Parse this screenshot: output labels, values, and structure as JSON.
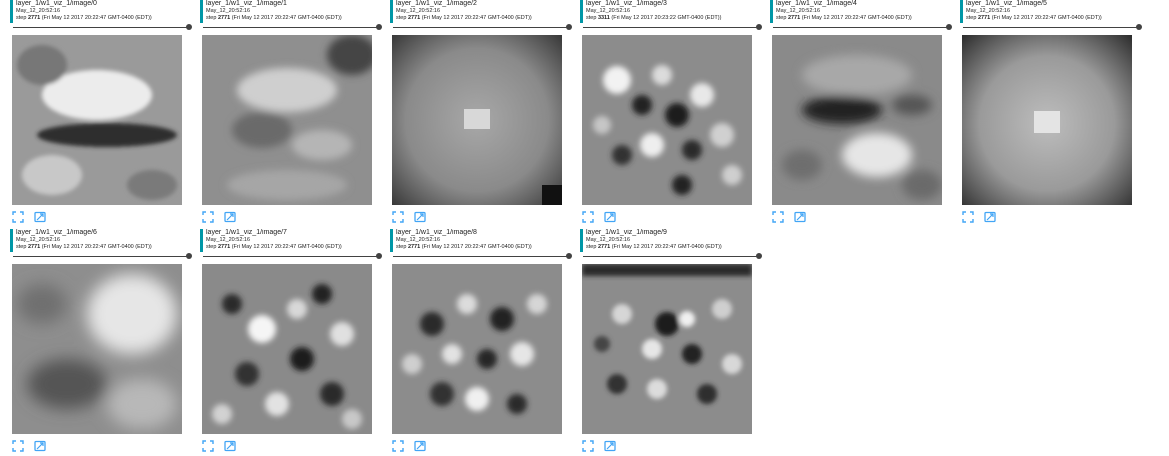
{
  "images": [
    {
      "title": "layer_1/w1_viz_1/image/0",
      "time": "May_12_20:52:16",
      "step_label": "step",
      "step": "2771",
      "timestamp": "(Fri May 12 2017 20:22:47 GMT-0400 (EDT))"
    },
    {
      "title": "layer_1/w1_viz_1/image/1",
      "time": "May_12_20:52:16",
      "step_label": "step",
      "step": "2771",
      "timestamp": "(Fri May 12 2017 20:22:47 GMT-0400 (EDT))"
    },
    {
      "title": "layer_1/w1_viz_1/image/2",
      "time": "May_12_20:52:16",
      "step_label": "step",
      "step": "2771",
      "timestamp": "(Fri May 12 2017 20:22:47 GMT-0400 (EDT))"
    },
    {
      "title": "layer_1/w1_viz_1/image/3",
      "time": "May_12_20:52:16",
      "step_label": "step",
      "step": "3311",
      "timestamp": "(Fri May 12 2017 20:23:22 GMT-0400 (EDT))"
    },
    {
      "title": "layer_1/w1_viz_1/image/4",
      "time": "May_12_20:52:16",
      "step_label": "step",
      "step": "2771",
      "timestamp": "(Fri May 12 2017 20:22:47 GMT-0400 (EDT))"
    },
    {
      "title": "layer_1/w1_viz_1/image/5",
      "time": "May_12_20:52:16",
      "step_label": "step",
      "step": "2771",
      "timestamp": "(Fri May 12 2017 20:22:47 GMT-0400 (EDT))"
    },
    {
      "title": "layer_1/w1_viz_1/image/6",
      "time": "May_12_20:52:16",
      "step_label": "step",
      "step": "2771",
      "timestamp": "(Fri May 12 2017 20:22:47 GMT-0400 (EDT))"
    },
    {
      "title": "layer_1/w1_viz_1/image/7",
      "time": "May_12_20:52:16",
      "step_label": "step",
      "step": "2771",
      "timestamp": "(Fri May 12 2017 20:22:47 GMT-0400 (EDT))"
    },
    {
      "title": "layer_1/w1_viz_1/image/8",
      "time": "May_12_20:52:16",
      "step_label": "step",
      "step": "2771",
      "timestamp": "(Fri May 12 2017 20:22:47 GMT-0400 (EDT))"
    },
    {
      "title": "layer_1/w1_viz_1/image/9",
      "time": "May_12_20:52:16",
      "step_label": "step",
      "step": "2771",
      "timestamp": "(Fri May 12 2017 20:22:47 GMT-0400 (EDT))"
    }
  ],
  "icons": {
    "expand": "fullscreen-expand-icon",
    "fit": "image-fit-icon"
  },
  "colors": {
    "accent": "#0097a7",
    "icon": "#42a5f5",
    "slider": "#424242"
  }
}
